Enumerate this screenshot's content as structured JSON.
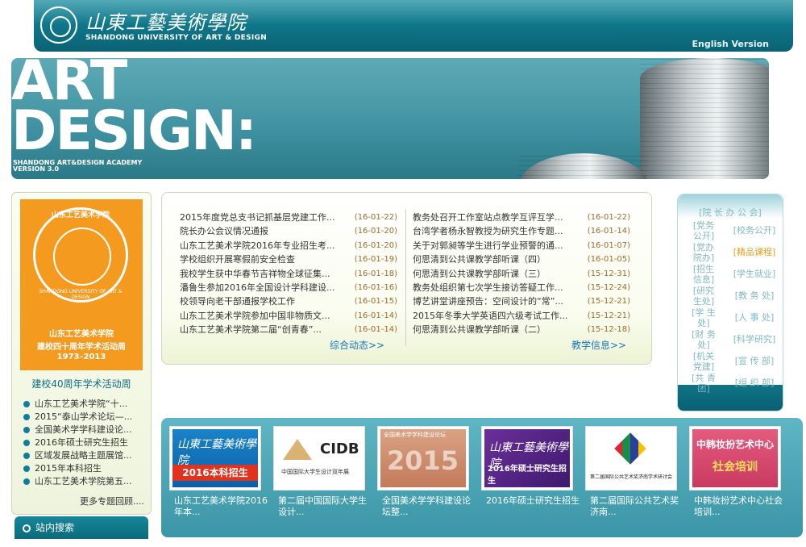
{
  "header": {
    "logo_cn": "山東工藝美術學院",
    "logo_en": "SHANDONG UNIVERSITY OF ART & DESIGN",
    "english_link": "English Version"
  },
  "banner": {
    "line1": "ART",
    "line2": "DESIGN:",
    "sub1": "SHANDONG ART&DESIGN ACADEMY",
    "sub2": "VERSION 3.0"
  },
  "poster": {
    "seal_text": "山东工艺美术学院",
    "seal_en": "SHANDONG UNIVERSITY OF ART & DESIGN",
    "line1": "山东工艺美术学院",
    "line2": "建校四十周年学术活动周",
    "line3": "1973–2013",
    "caption": "建校40周年学术活动周"
  },
  "topics": [
    "山东工艺美术学院“十...",
    "2015“泰山学术论坛—...",
    "全国美术学学科建设论...",
    "2016年硕士研究生招生",
    "区域发展战略主题展馆...",
    "2015年本科招生",
    "山东工艺美术学院第五..."
  ],
  "more_topics": "更多专题回顾....",
  "site_search": "站内搜索",
  "news_left": [
    {
      "title": "2015年度党总支书记抓基层党建工作...",
      "date": "(16-01-22)"
    },
    {
      "title": "院长办公会议情况通报",
      "date": "(16-01-20)"
    },
    {
      "title": "山东工艺美术学院2016年专业招生考...",
      "date": "(16-01-20)"
    },
    {
      "title": "学校组织开展寒假前安全检查",
      "date": "(16-01-19)"
    },
    {
      "title": "我校学生获中华春节吉祥物全球征集...",
      "date": "(16-01-18)"
    },
    {
      "title": "潘鲁生参加2016年全国设计学科建设...",
      "date": "(16-01-16)"
    },
    {
      "title": "校领导向老干部通报学校工作",
      "date": "(16-01-15)"
    },
    {
      "title": "山东工艺美术学院参加中国非物质文...",
      "date": "(16-01-14)"
    },
    {
      "title": "山东工艺美术学院第二届“创青春”...",
      "date": "(16-01-14)"
    }
  ],
  "news_right": [
    {
      "title": "教务处召开工作室站点教学互评互学...",
      "date": "(16-01-22)"
    },
    {
      "title": "台湾学者杨永智教授为研究生作专题...",
      "date": "(16-01-14)"
    },
    {
      "title": "关于对郭昶等学生进行学业预警的通...",
      "date": "(16-01-07)"
    },
    {
      "title": "何思清到公共课教学部听课（四）",
      "date": "(16-01-05)"
    },
    {
      "title": "何思清到公共课教学部听课（三）",
      "date": "(15-12-31)"
    },
    {
      "title": "教务处组织第七次学生接访答疑工作...",
      "date": "(15-12-24)"
    },
    {
      "title": "博艺讲堂讲座预告：空间设计的“常”...",
      "date": "(15-12-21)"
    },
    {
      "title": "2015年冬季大学英语四六级考试工作...",
      "date": "(15-12-21)"
    },
    {
      "title": "何思清到公共课教学部听课（二）",
      "date": "(15-12-18)"
    }
  ],
  "more_general": "综合动态>>",
  "more_teaching": "教学信息>>",
  "quick_links": {
    "top": "[院 长 办 公 会]",
    "left": [
      "[党务公开]",
      "[党办院办]",
      "[招生信息]",
      "[研究生处]",
      "[学 生 处]",
      "[财 务 处]",
      "[机关党建]",
      "[共 青 团]"
    ],
    "right": [
      "[校务公开]",
      "[精品课程]",
      "[学生就业]",
      "[教 务 处]",
      "[人 事 处]",
      "[科学研究]",
      "[宣 传 部]",
      "[组 织 部]"
    ]
  },
  "thumbs": [
    {
      "caption": "山东工艺美术学院2016年本...",
      "img_text": "2016本科招生"
    },
    {
      "caption": "第二届中国国际大学生设计...",
      "img_text": "CIDB",
      "img_sub": "中国国际大学生设计双年展"
    },
    {
      "caption": "全国美术学学科建设论坛整...",
      "img_text": "2015",
      "img_sub": "全国美术学学科建设论坛"
    },
    {
      "caption": "2016年硕士研究生招生",
      "img_text": "2016年硕士研究生招生"
    },
    {
      "caption": "第二届国际公共艺术奖济南...",
      "img_text": "第二届国际公共艺术奖济南学术研讨会"
    },
    {
      "caption": "中韩妆扮艺术中心社会培训...",
      "img_text": "中韩妆扮艺术中心",
      "img_sub": "社会培训"
    }
  ],
  "colors": {
    "teal": "#0f7488",
    "orange": "#f39a1f",
    "date": "#a06a2c",
    "link": "#1a77b8"
  }
}
